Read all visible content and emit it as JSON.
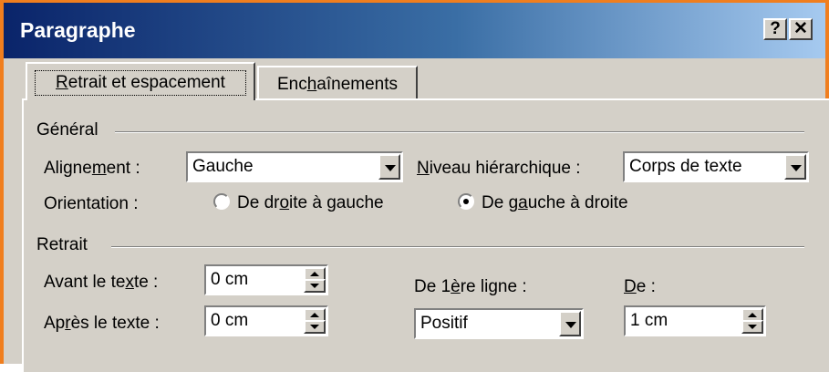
{
  "window": {
    "title": "Paragraphe",
    "help_label": "?",
    "close_label": "✕"
  },
  "tabs": [
    {
      "label_pre": "",
      "label_ul": "R",
      "label_post": "etrait et espacement",
      "active": true
    },
    {
      "label_pre": "Enc",
      "label_ul": "h",
      "label_post": "aînements",
      "active": false
    }
  ],
  "general": {
    "title": "Général",
    "alignment": {
      "label_pre": "Aligne",
      "label_ul": "m",
      "label_post": "ent :",
      "value": "Gauche"
    },
    "outline_level": {
      "label_pre": "",
      "label_ul": "N",
      "label_post": "iveau hiérarchique :",
      "value": "Corps de texte"
    },
    "orientation": {
      "label": "Orientation :",
      "option_rtl_pre": "De dr",
      "option_rtl_ul": "o",
      "option_rtl_post": "ite à gauche",
      "option_ltr_pre": "De g",
      "option_ltr_ul": "a",
      "option_ltr_post": "uche à droite",
      "selected": "ltr"
    }
  },
  "indent": {
    "title": "Retrait",
    "before": {
      "label_pre": "Avant le te",
      "label_ul": "x",
      "label_post": "te :",
      "value": "0 cm"
    },
    "after": {
      "label_pre": "Ap",
      "label_ul": "r",
      "label_post": "ès le texte :",
      "value": "0 cm"
    },
    "first_line": {
      "label_pre": "De 1",
      "label_ul": "è",
      "label_post": "re ligne :",
      "value": "Positif"
    },
    "by": {
      "label_pre": "",
      "label_ul": "D",
      "label_post": "e :",
      "value": "1 cm"
    }
  }
}
